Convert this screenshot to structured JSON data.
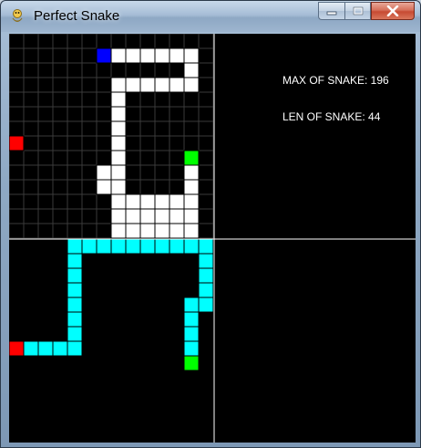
{
  "window": {
    "title": "Perfect Snake",
    "caption_buttons": [
      {
        "name": "minimize",
        "icon": "minimize-icon"
      },
      {
        "name": "maximize",
        "icon": "maximize-icon"
      },
      {
        "name": "close",
        "icon": "close-icon"
      }
    ]
  },
  "info": {
    "max_label": "MAX OF SNAKE: 196",
    "len_label": "LEN OF SNAKE: 44"
  },
  "colors": {
    "background": "#000000",
    "grid_line": "#3a3a3a",
    "divider": "#ffffff",
    "snake_body": "#ffffff",
    "snake_head": "#0000ff",
    "food": "#ff0000",
    "path_head": "#00ff00",
    "path": "#00ffff",
    "cell_outline": "#000000"
  },
  "board": {
    "columns": 14,
    "rows": 14,
    "grid_shown": true,
    "snake": {
      "head": [
        6,
        1
      ],
      "body": [
        [
          7,
          1
        ],
        [
          8,
          1
        ],
        [
          9,
          1
        ],
        [
          10,
          1
        ],
        [
          11,
          1
        ],
        [
          12,
          1
        ],
        [
          12,
          2
        ],
        [
          12,
          3
        ],
        [
          11,
          3
        ],
        [
          10,
          3
        ],
        [
          9,
          3
        ],
        [
          8,
          3
        ],
        [
          7,
          3
        ],
        [
          7,
          4
        ],
        [
          7,
          5
        ],
        [
          7,
          6
        ],
        [
          7,
          7
        ],
        [
          7,
          8
        ],
        [
          7,
          9
        ],
        [
          6,
          9
        ],
        [
          6,
          10
        ],
        [
          7,
          10
        ],
        [
          7,
          11
        ],
        [
          7,
          12
        ],
        [
          7,
          13
        ],
        [
          8,
          11
        ],
        [
          8,
          12
        ],
        [
          8,
          13
        ],
        [
          9,
          11
        ],
        [
          9,
          12
        ],
        [
          9,
          13
        ],
        [
          10,
          11
        ],
        [
          10,
          12
        ],
        [
          10,
          13
        ],
        [
          11,
          11
        ],
        [
          11,
          12
        ],
        [
          11,
          13
        ],
        [
          12,
          11
        ],
        [
          12,
          12
        ],
        [
          12,
          13
        ],
        [
          12,
          10
        ],
        [
          12,
          9
        ]
      ],
      "food": [
        0,
        7
      ],
      "target": [
        12,
        8
      ]
    }
  },
  "path_panel": {
    "columns": 14,
    "rows": 14,
    "grid_shown": false,
    "path": {
      "cells": [
        [
          4,
          0
        ],
        [
          5,
          0
        ],
        [
          6,
          0
        ],
        [
          7,
          0
        ],
        [
          8,
          0
        ],
        [
          9,
          0
        ],
        [
          10,
          0
        ],
        [
          11,
          0
        ],
        [
          12,
          0
        ],
        [
          13,
          0
        ],
        [
          4,
          1
        ],
        [
          4,
          2
        ],
        [
          4,
          3
        ],
        [
          4,
          4
        ],
        [
          4,
          5
        ],
        [
          4,
          6
        ],
        [
          4,
          7
        ],
        [
          3,
          7
        ],
        [
          2,
          7
        ],
        [
          1,
          7
        ],
        [
          13,
          1
        ],
        [
          13,
          2
        ],
        [
          13,
          3
        ],
        [
          13,
          4
        ],
        [
          12,
          4
        ],
        [
          12,
          5
        ],
        [
          12,
          6
        ],
        [
          12,
          7
        ]
      ],
      "food": [
        0,
        7
      ],
      "target": [
        12,
        8
      ]
    }
  }
}
